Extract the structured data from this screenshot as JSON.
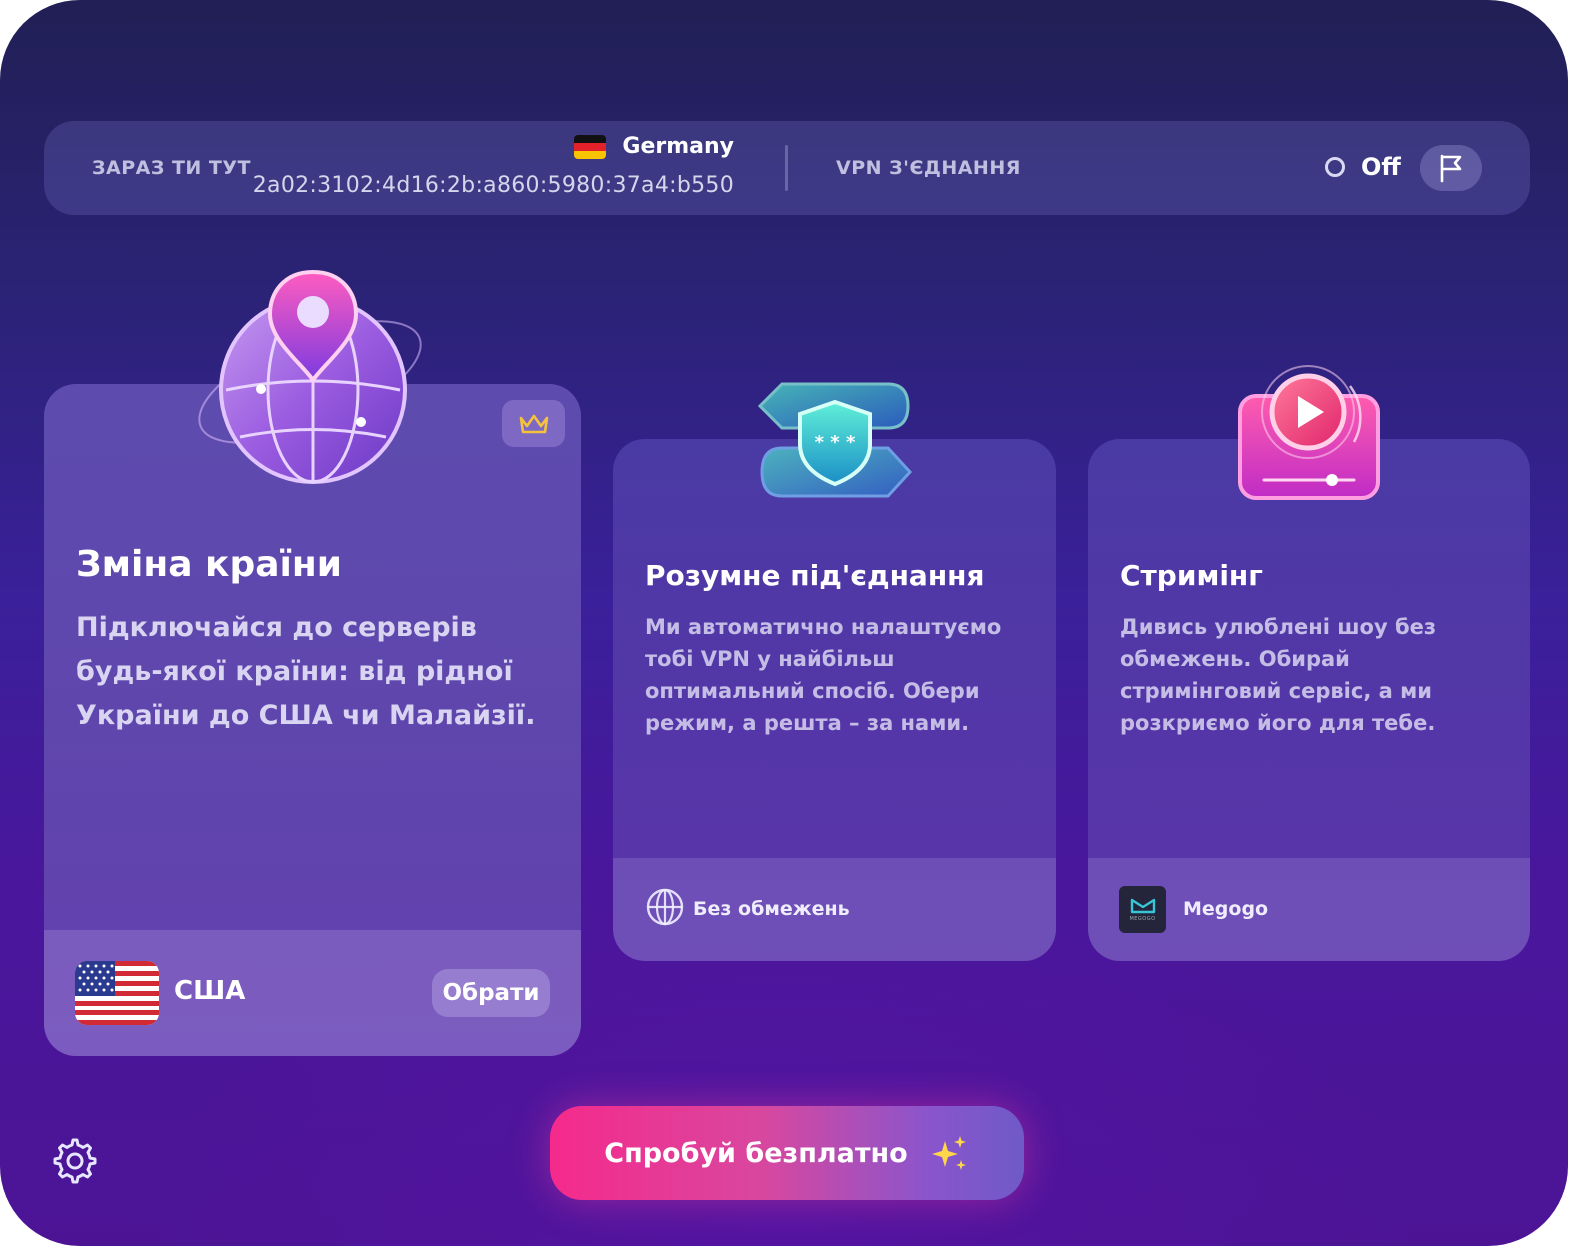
{
  "statusbar": {
    "location_caption": "ЗАРАЗ ТИ ТУТ",
    "country": "Germany",
    "ip_address": "2a02:3102:4d16:2b:a860:5980:37a4:b550",
    "vpn_caption": "VPN З'ЄДНАННЯ",
    "vpn_state": "Off",
    "icons": {
      "country_flag": "germany-flag-icon",
      "status": "ring-icon",
      "report": "flag-icon"
    }
  },
  "cards": {
    "country_change": {
      "title": "Зміна країни",
      "description": "Підключайся до серверів будь-якої країни: від рідної України до США чи Малайзії.",
      "selected_country": "США",
      "choose_label": "Обрати",
      "icons": {
        "illustration": "globe-pin-icon",
        "premium": "crown-icon",
        "flag": "usa-flag-icon"
      }
    },
    "smart_connect": {
      "title": "Розумне під'єднання",
      "description": "Ми автоматично налаштуємо тобі VPN у найбільш оптимальний спосіб. Обери режим, а решта – за нами.",
      "mode_label": "Без обмежень",
      "icons": {
        "illustration": "shield-password-icon",
        "mode": "globe-icon"
      }
    },
    "streaming": {
      "title": "Стримінг",
      "description": "Дивись улюблені шоу без обмежень. Обирай стримінговий сервіс, а ми розкриємо його для тебе.",
      "service_label": "Megogo",
      "logo_text": "MEGOGO",
      "icons": {
        "illustration": "video-player-icon",
        "service": "megogo-logo-icon"
      }
    }
  },
  "cta": {
    "label": "Спробуй безплатно",
    "icon": "sparkles-icon"
  },
  "settings": {
    "icon": "gear-icon"
  },
  "colors": {
    "accent_pink": "#f52a8b",
    "accent_violet": "#6f5ac8",
    "crown_gold": "#f5c33b"
  }
}
